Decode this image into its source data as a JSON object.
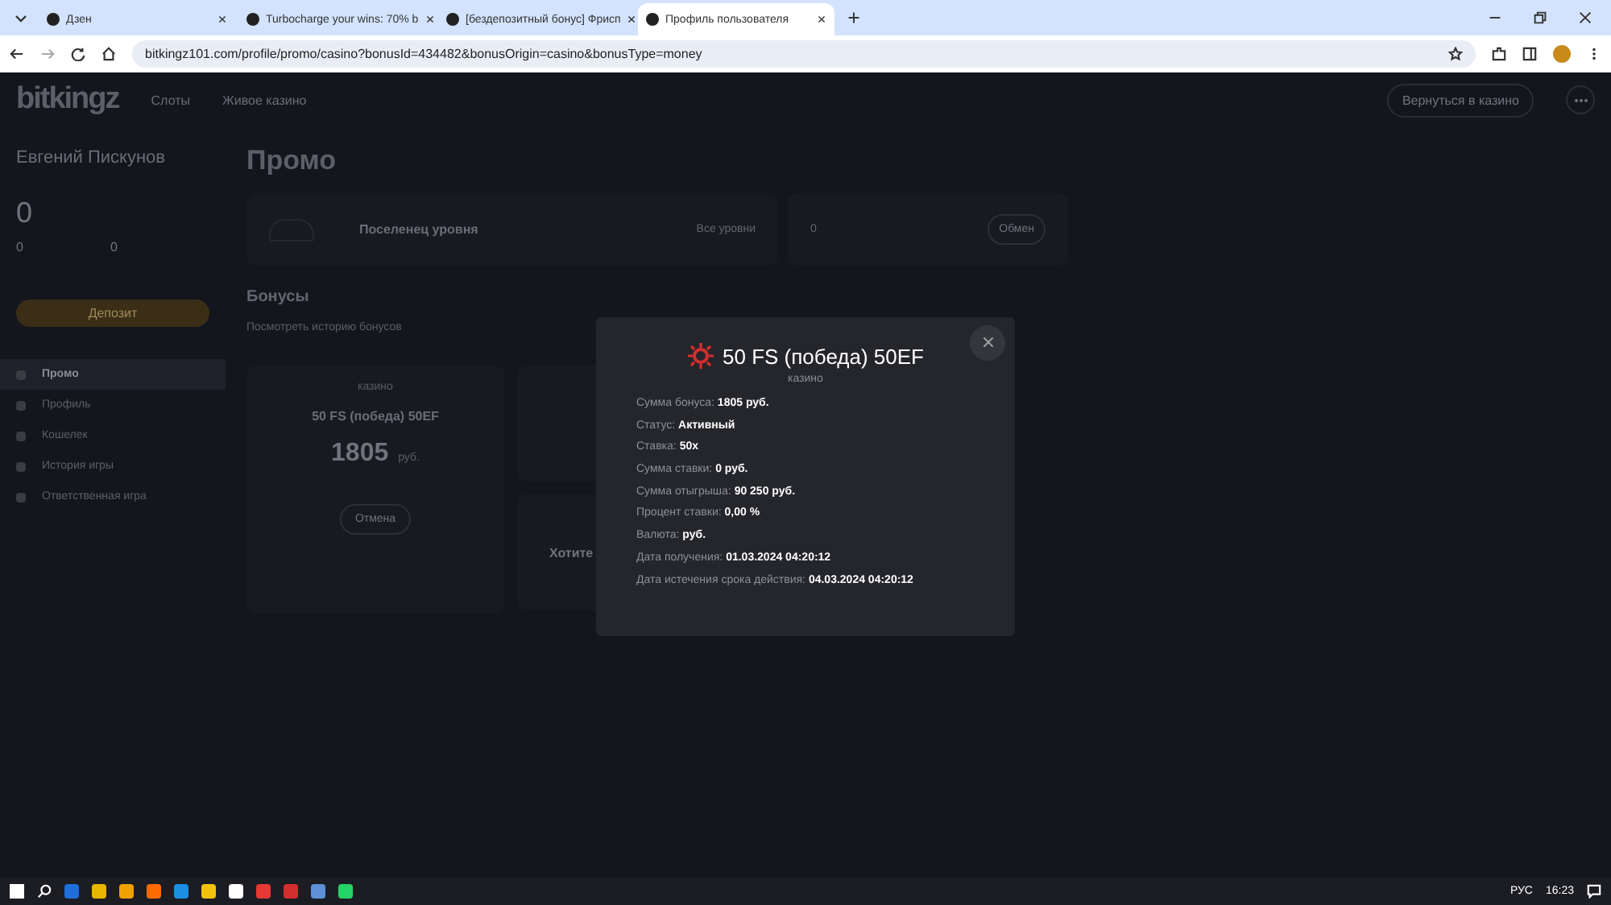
{
  "browser": {
    "tabs": [
      {
        "title": "Дзен",
        "selected": false
      },
      {
        "title": "Turbocharge your wins: 70% b",
        "selected": false
      },
      {
        "title": "[бездепозитный бонус] Фрисп",
        "selected": false
      },
      {
        "title": "Профиль пользователя",
        "selected": true
      }
    ],
    "url": "bitkingz101.com/profile/promo/casino?bonusId=434482&bonusOrigin=casino&bonusType=money"
  },
  "site": {
    "logo": "bitkingz",
    "nav": [
      "Слоты",
      "Живое казино"
    ],
    "back_button": "Вернуться в казино"
  },
  "sidebar": {
    "user": "Евгений Пискунов",
    "points": "0",
    "stats": [
      "0",
      "0"
    ],
    "deposit_button": "Депозит",
    "menu": [
      {
        "label": "Промо",
        "selected": true
      },
      {
        "label": "Профиль",
        "selected": false
      },
      {
        "label": "Кошелек",
        "selected": false
      },
      {
        "label": "История игры",
        "selected": false
      },
      {
        "label": "Ответственная игра",
        "selected": false
      }
    ]
  },
  "main": {
    "title": "Промо",
    "level_card": {
      "title": "Поселенец уровня",
      "link": "Все уровни"
    },
    "exchange_card": {
      "value": "0",
      "button": "Обмен"
    },
    "bonuses_title": "Бонусы",
    "history_link": "Посмотреть историю бонусов",
    "bonus_card": {
      "category": "казино",
      "name": "50 FS (победа) 50EF",
      "amount": "1805",
      "currency": "руб.",
      "cancel_button": "Отмена"
    },
    "side_card_text": "Хотите"
  },
  "modal": {
    "title": "50 FS (победа) 50EF",
    "category": "казино",
    "rows": [
      {
        "label": "Сумма бонуса:",
        "value": "1805 руб."
      },
      {
        "label": "Статус:",
        "value": "Активный"
      },
      {
        "label": "Ставка:",
        "value": "50x"
      },
      {
        "label": "Сумма ставки:",
        "value": "0 руб."
      },
      {
        "label": "Сумма отыгрыша:",
        "value": "90 250 руб."
      },
      {
        "label": "Процент ставки:",
        "value": "0,00 %"
      },
      {
        "label": "Валюта:",
        "value": "руб."
      },
      {
        "label": "Дата получения:",
        "value": "01.03.2024 04:20:12"
      },
      {
        "label": "Дата истечения срока действия:",
        "value": "04.03.2024 04:20:12"
      }
    ]
  },
  "taskbar": {
    "language": "РУС",
    "time": "16:23"
  }
}
